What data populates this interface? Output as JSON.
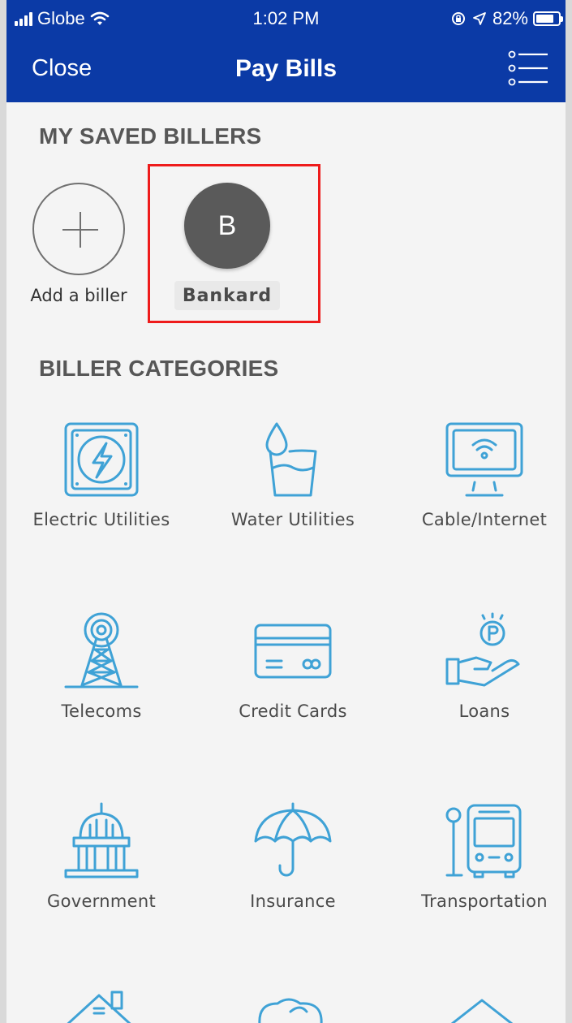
{
  "status_bar": {
    "carrier": "Globe",
    "time": "1:02 PM",
    "battery": "82%",
    "battery_level": 0.82
  },
  "nav": {
    "close_label": "Close",
    "title": "Pay Bills",
    "menu_icon": "list-menu-icon"
  },
  "saved_billers": {
    "title": "MY SAVED BILLERS",
    "add_label": "Add a biller",
    "items": [
      {
        "initial": "B",
        "name": "Bankard"
      }
    ]
  },
  "categories": {
    "title": "BILLER CATEGORIES",
    "items": [
      {
        "label": "Electric Utilities",
        "icon": "electric-icon"
      },
      {
        "label": "Water Utilities",
        "icon": "water-icon"
      },
      {
        "label": "Cable/Internet",
        "icon": "cable-internet-icon"
      },
      {
        "label": "Telecoms",
        "icon": "telecom-tower-icon"
      },
      {
        "label": "Credit Cards",
        "icon": "credit-card-icon"
      },
      {
        "label": "Loans",
        "icon": "loan-coin-hand-icon"
      },
      {
        "label": "Government",
        "icon": "government-building-icon"
      },
      {
        "label": "Insurance",
        "icon": "umbrella-icon"
      },
      {
        "label": "Transportation",
        "icon": "bus-icon"
      }
    ]
  },
  "colors": {
    "header_bg": "#0b3aa6",
    "icon_blue": "#3fa2d6",
    "highlight": "#ee1b1b",
    "avatar_bg": "#5a5a5a"
  }
}
